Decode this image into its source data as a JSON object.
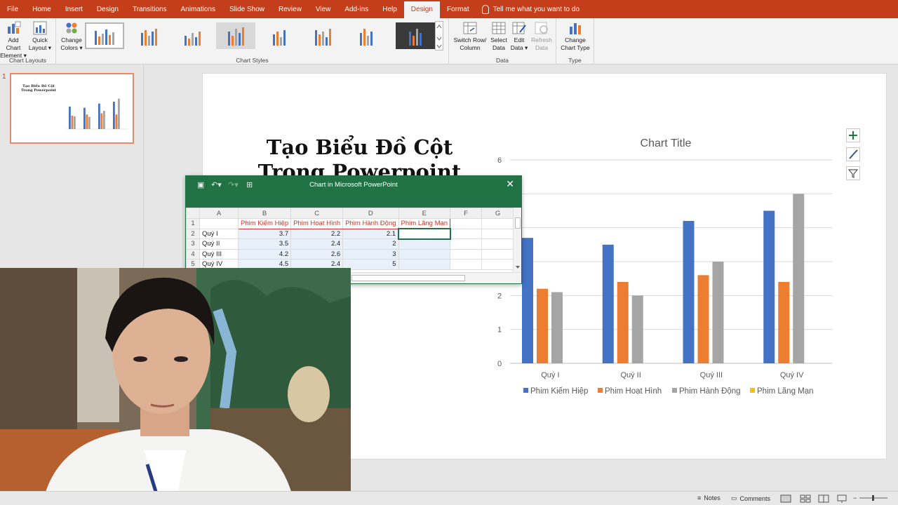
{
  "menu": {
    "tabs": [
      "File",
      "Home",
      "Insert",
      "Design",
      "Transitions",
      "Animations",
      "Slide Show",
      "Review",
      "View",
      "Add-ins",
      "Help",
      "Design",
      "Format"
    ],
    "active_index": 11,
    "tell_me": "Tell me what you want to do"
  },
  "ribbon": {
    "add_chart_element": [
      "Add Chart",
      "Element ▾"
    ],
    "quick_layout": [
      "Quick",
      "Layout ▾"
    ],
    "chart_layouts_label": "Chart Layouts",
    "change_colors": [
      "Change",
      "Colors ▾"
    ],
    "chart_styles_label": "Chart Styles",
    "switch_row_column": [
      "Switch Row/",
      "Column"
    ],
    "select_data": [
      "Select",
      "Data"
    ],
    "edit_data": [
      "Edit",
      "Data ▾"
    ],
    "refresh_data": [
      "Refresh",
      "Data"
    ],
    "data_label": "Data",
    "change_chart_type": [
      "Change",
      "Chart Type"
    ],
    "type_label": "Type"
  },
  "thumbnail": {
    "number": "1"
  },
  "slide": {
    "title_line1": "Tạo Biểu Đồ Cột",
    "title_line2": "Trong Powerpoint"
  },
  "excel": {
    "window_title": "Chart in Microsoft PowerPoint",
    "close": "✕",
    "columns": [
      "",
      "A",
      "B",
      "C",
      "D",
      "E",
      "F",
      "G"
    ],
    "rows": [
      {
        "num": "1",
        "cells": [
          "",
          "Phim Kiếm Hiệp",
          "Phim Hoạt Hình",
          "Phim Hành Động",
          "Phim Lãng Mạn",
          "",
          ""
        ]
      },
      {
        "num": "2",
        "cells": [
          "Quý I",
          "3.7",
          "2.2",
          "2.1",
          "",
          "",
          ""
        ]
      },
      {
        "num": "3",
        "cells": [
          "Quý II",
          "3.5",
          "2.4",
          "2",
          "",
          "",
          ""
        ]
      },
      {
        "num": "4",
        "cells": [
          "Quý III",
          "4.2",
          "2.6",
          "3",
          "",
          "",
          ""
        ]
      },
      {
        "num": "5",
        "cells": [
          "Quý IV",
          "4.5",
          "2.4",
          "5",
          "",
          "",
          ""
        ]
      }
    ]
  },
  "chart_data": {
    "type": "bar",
    "title": "Chart Title",
    "categories": [
      "Quý I",
      "Quý II",
      "Quý III",
      "Quý IV"
    ],
    "series": [
      {
        "name": "Phim Kiếm Hiệp",
        "values": [
          3.7,
          3.5,
          4.2,
          4.5
        ],
        "color": "#4472c4"
      },
      {
        "name": "Phim Hoạt Hình",
        "values": [
          2.2,
          2.4,
          2.6,
          2.4
        ],
        "color": "#ed7d31"
      },
      {
        "name": "Phim Hành Động",
        "values": [
          2.1,
          2.0,
          3.0,
          5.0
        ],
        "color": "#a5a5a5"
      },
      {
        "name": "Phim Lãng Mạn",
        "values": [
          null,
          null,
          null,
          null
        ],
        "color": "#ffc000"
      }
    ],
    "ylim": [
      0,
      6
    ],
    "yticks": [
      0,
      1,
      2,
      6
    ],
    "grid": true,
    "legend": "bottom"
  },
  "statusbar": {
    "notes": "Notes",
    "comments": "Comments"
  },
  "colors": {
    "accent": "#c43e1c",
    "excel": "#217346"
  }
}
